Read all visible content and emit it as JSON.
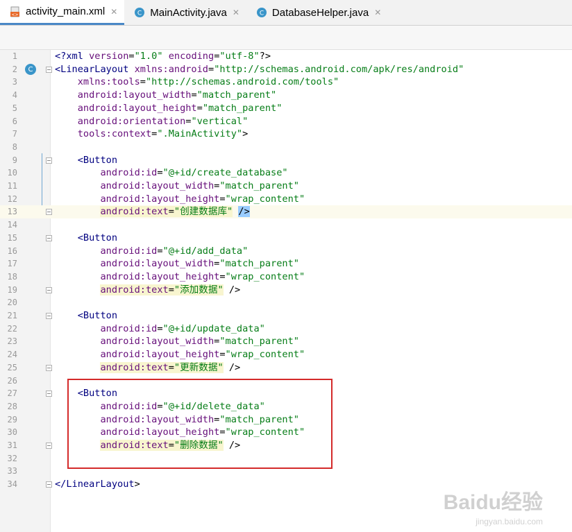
{
  "tabs": [
    {
      "label": "activity_main.xml",
      "active": true,
      "icon": "xml-file-icon"
    },
    {
      "label": "MainActivity.java",
      "active": false,
      "icon": "java-class-icon"
    },
    {
      "label": "DatabaseHelper.java",
      "active": false,
      "icon": "java-class-icon"
    }
  ],
  "gutter_icon": "C",
  "lines": [
    {
      "n": "1",
      "t": "<?xml version=\"1.0\" encoding=\"utf-8\"?>"
    },
    {
      "n": "2",
      "t": "<LinearLayout xmlns:android=\"http://schemas.android.com/apk/res/android\""
    },
    {
      "n": "3",
      "t": "    xmlns:tools=\"http://schemas.android.com/tools\""
    },
    {
      "n": "4",
      "t": "    android:layout_width=\"match_parent\""
    },
    {
      "n": "5",
      "t": "    android:layout_height=\"match_parent\""
    },
    {
      "n": "6",
      "t": "    android:orientation=\"vertical\""
    },
    {
      "n": "7",
      "t": "    tools:context=\".MainActivity\">"
    },
    {
      "n": "8",
      "t": ""
    },
    {
      "n": "9",
      "t": "    <Button"
    },
    {
      "n": "10",
      "t": "        android:id=\"@+id/create_database\""
    },
    {
      "n": "11",
      "t": "        android:layout_width=\"match_parent\""
    },
    {
      "n": "12",
      "t": "        android:layout_height=\"wrap_content\""
    },
    {
      "n": "13",
      "t": "        android:text=\"创建数据库\" />"
    },
    {
      "n": "14",
      "t": ""
    },
    {
      "n": "15",
      "t": "    <Button"
    },
    {
      "n": "16",
      "t": "        android:id=\"@+id/add_data\""
    },
    {
      "n": "17",
      "t": "        android:layout_width=\"match_parent\""
    },
    {
      "n": "18",
      "t": "        android:layout_height=\"wrap_content\""
    },
    {
      "n": "19",
      "t": "        android:text=\"添加数据\" />"
    },
    {
      "n": "20",
      "t": ""
    },
    {
      "n": "21",
      "t": "    <Button"
    },
    {
      "n": "22",
      "t": "        android:id=\"@+id/update_data\""
    },
    {
      "n": "23",
      "t": "        android:layout_width=\"match_parent\""
    },
    {
      "n": "24",
      "t": "        android:layout_height=\"wrap_content\""
    },
    {
      "n": "25",
      "t": "        android:text=\"更新数据\" />"
    },
    {
      "n": "26",
      "t": ""
    },
    {
      "n": "27",
      "t": "    <Button"
    },
    {
      "n": "28",
      "t": "        android:id=\"@+id/delete_data\""
    },
    {
      "n": "29",
      "t": "        android:layout_width=\"match_parent\""
    },
    {
      "n": "30",
      "t": "        android:layout_height=\"wrap_content\""
    },
    {
      "n": "31",
      "t": "        android:text=\"删除数据\" />"
    },
    {
      "n": "32",
      "t": ""
    },
    {
      "n": "33",
      "t": ""
    },
    {
      "n": "34",
      "t": "</LinearLayout>"
    }
  ],
  "watermark": "Baidu经验",
  "watermark_url": "jingyan.baidu.com",
  "colors": {
    "accent": "#4a88c7",
    "highlight_box": "#d42a2a"
  }
}
